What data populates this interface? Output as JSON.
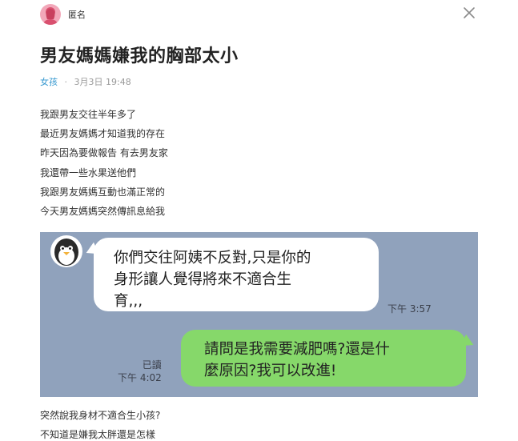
{
  "header": {
    "author": "匿名",
    "avatar_color": "#f2a7b9",
    "close_icon": "close-icon"
  },
  "post": {
    "title": "男友媽媽嫌我的胸部太小",
    "board": "女孩",
    "separator": "·",
    "date": "3月3日 19:48",
    "body_lines": [
      "我跟男友交往半年多了",
      "最近男友媽媽才知道我的存在",
      "昨天因為要做報告 有去男友家",
      "我還帶一些水果送他們",
      "我跟男友媽媽互動也滿正常的",
      "今天男友媽媽突然傳訊息給我"
    ],
    "footer_lines": [
      "突然說我身材不適合生小孩?",
      "不知道是嫌我太胖還是怎樣"
    ]
  },
  "chat": {
    "background": "#90a2bc",
    "incoming": {
      "avatar_icon": "penguin-icon",
      "lines": [
        "你們交往阿姨不反對,只是你的",
        "身形讓人覺得將來不適合生",
        "育,,,"
      ],
      "time": "下午 3:57"
    },
    "outgoing": {
      "lines": [
        "請問是我需要減肥嗎?還是什",
        "麼原因?我可以改進!"
      ],
      "read_label": "已讀",
      "time": "下午 4:02",
      "bubble_color": "#86d86a"
    }
  }
}
